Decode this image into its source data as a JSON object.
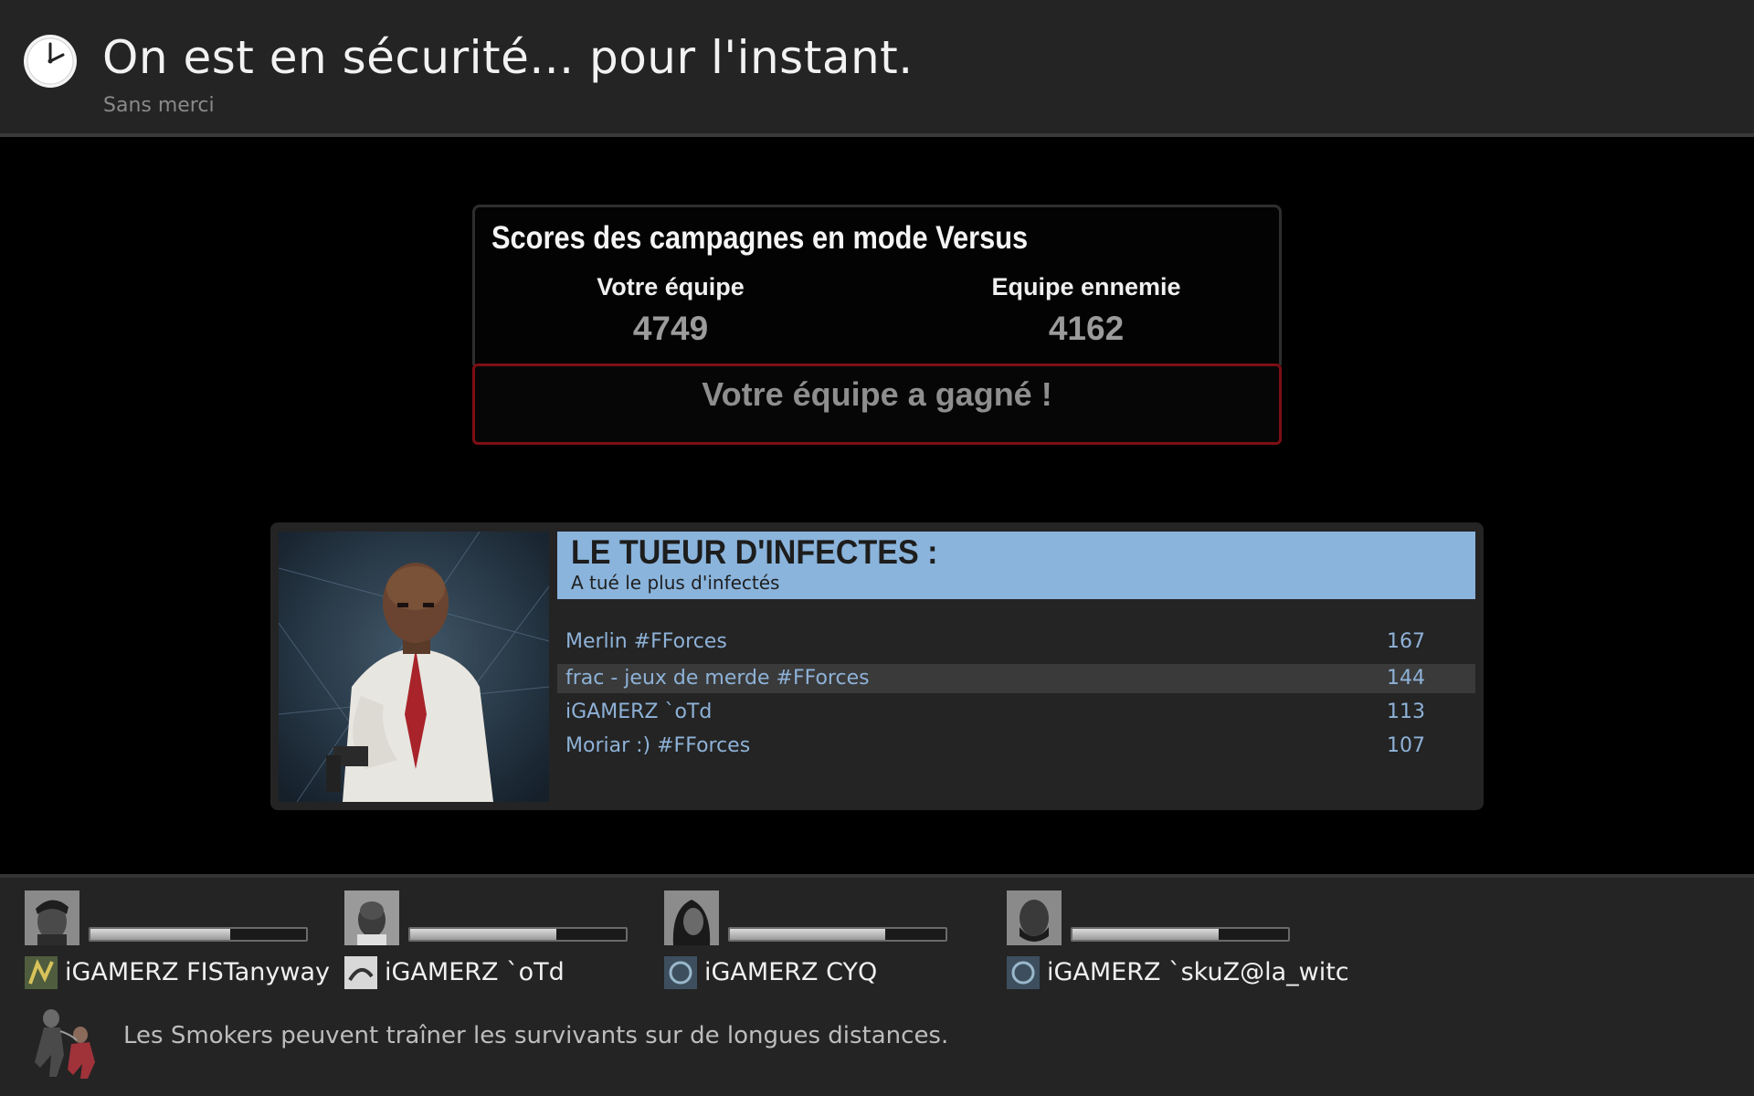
{
  "header": {
    "title": "On est en sécurité... pour l'instant.",
    "subtitle": "Sans merci",
    "icon": "clock-icon"
  },
  "scores": {
    "title": "Scores des campagnes en mode Versus",
    "your_team_label": "Votre équipe",
    "enemy_team_label": "Equipe ennemie",
    "your_team_score": "4749",
    "enemy_team_score": "4162",
    "result": "Votre équipe a gagné !",
    "result_border_color": "#7c0f14"
  },
  "award": {
    "title": "LE TUEUR D'INFECTES :",
    "subtitle": "A tué le plus d'infectés",
    "header_color": "#8ab4dc",
    "rows": [
      {
        "name": "Merlin #FForces",
        "value": "167"
      },
      {
        "name": "frac - jeux de merde #FForces",
        "value": "144"
      },
      {
        "name": "iGAMERZ `oTd",
        "value": "113"
      },
      {
        "name": "Moriar :) #FForces",
        "value": "107"
      }
    ]
  },
  "players": [
    {
      "name": "iGAMERZ FISTanyway",
      "health": 0.65
    },
    {
      "name": "iGAMERZ `oTd",
      "health": 0.68
    },
    {
      "name": "iGAMERZ CYQ",
      "health": 0.72
    },
    {
      "name": "iGAMERZ `skuZ@la_witc",
      "health": 0.68
    }
  ],
  "tip": {
    "text": "Les Smokers peuvent traîner les survivants sur de longues distances.",
    "icon": "smoker-icon"
  }
}
